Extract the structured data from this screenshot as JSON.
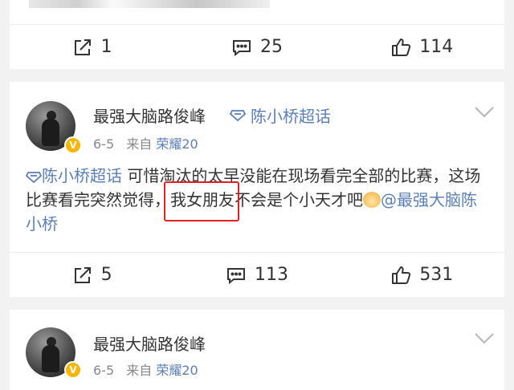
{
  "posts": [
    {
      "actions": {
        "repost": "1",
        "comment": "25",
        "like": "114"
      }
    },
    {
      "username": "最强大脑路俊峰",
      "topic_tag": "陈小桥超话",
      "date": "6-5",
      "from_label": "来自",
      "device": "荣耀20",
      "badge": "V",
      "text": {
        "topic": "陈小桥超话",
        "part1": " 可惜淘汰的太早没能在现场看完全部的比赛，这场比赛看完突然觉得，",
        "highlight": "我女朋友",
        "part2": "不会是个小天才吧",
        "mention": "@最强大脑陈小桥"
      },
      "actions": {
        "repost": "5",
        "comment": "113",
        "like": "531"
      }
    },
    {
      "username": "最强大脑路俊峰",
      "date": "6-5",
      "from_label": "来自",
      "device": "荣耀20",
      "badge": "V"
    }
  ],
  "icons": {
    "repost": "share-icon",
    "comment": "comment-icon",
    "like": "thumbs-up-icon",
    "menu": "chevron-down-icon",
    "topic": "topic-diamond-icon"
  },
  "colors": {
    "link": "#5b7fb5",
    "highlight_box": "#e02020",
    "badge": "#f7b500"
  }
}
